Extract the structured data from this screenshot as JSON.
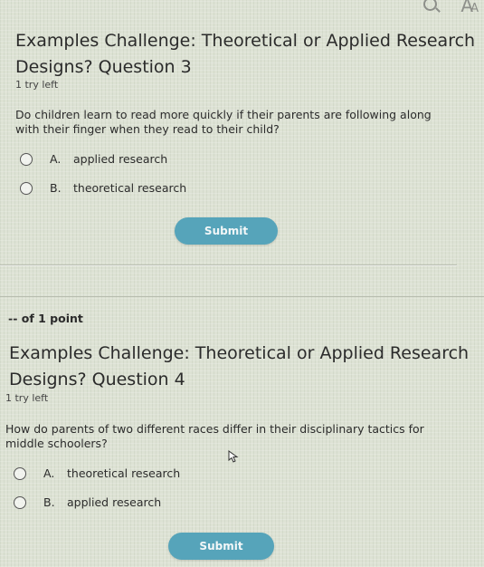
{
  "toolbar": {
    "font_icon_label": "A",
    "font_icon_small": "A"
  },
  "questions": [
    {
      "title_line1": "Examples Challenge: Theoretical or Applied Research",
      "title_line2": "Designs? Question 3",
      "tries": "1 try left",
      "text": "Do children learn to read more quickly if their parents are following along with their finger when they read to their child?",
      "options": [
        {
          "letter": "A.",
          "label": "applied research"
        },
        {
          "letter": "B.",
          "label": "theoretical research"
        }
      ],
      "submit_label": "Submit"
    },
    {
      "points": "-- of 1 point",
      "title_line1": "Examples Challenge: Theoretical or Applied Research",
      "title_line2": "Designs? Question 4",
      "tries": "1 try left",
      "text": "How do parents of two different races differ in their disciplinary tactics for middle schoolers?",
      "options": [
        {
          "letter": "A.",
          "label": "theoretical research"
        },
        {
          "letter": "B.",
          "label": "applied research"
        }
      ],
      "submit_label": "Submit"
    }
  ],
  "colors": {
    "submit_bg": "#56a4ba",
    "background": "#dde2d4"
  }
}
